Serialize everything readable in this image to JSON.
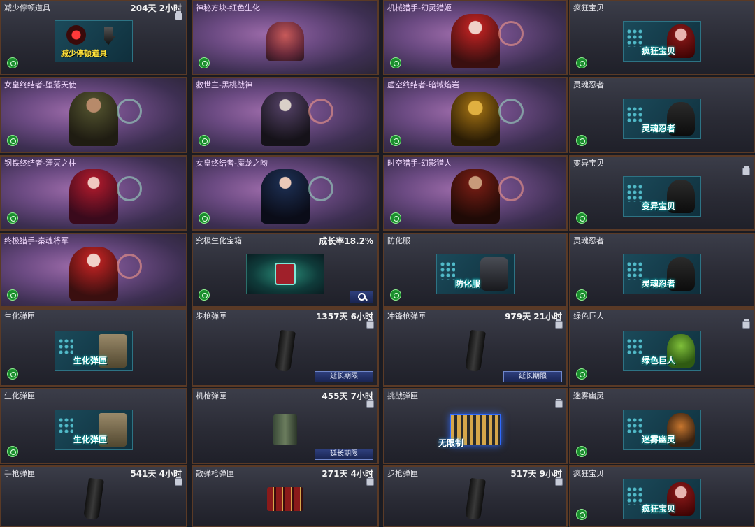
{
  "grid": {
    "rows": [
      [
        {
          "title": "减少停顿道具",
          "timer": "204天 2小时",
          "trash": true,
          "badge": true,
          "art": "reducer",
          "art_label": "减少停顿道具"
        },
        {
          "title": "神秘方块-红色生化",
          "theme": "purple",
          "badge": true,
          "art": "hero-small"
        },
        {
          "title": "机械猎手-幻灵猎姬",
          "theme": "purple",
          "badge": true,
          "art": "hero",
          "emblem": "red"
        },
        {
          "title": "疯狂宝贝",
          "badge": true,
          "art": "hexbox",
          "art_label": "疯狂宝贝",
          "art_figure": "red"
        }
      ],
      [
        {
          "title": "女皇终结者-堕落天使",
          "theme": "purple",
          "badge": true,
          "art": "hero",
          "emblem": "green"
        },
        {
          "title": "救世主-黑桃战神",
          "theme": "purple",
          "badge": true,
          "art": "hero",
          "emblem": "red"
        },
        {
          "title": "虚空终结者-暗域焰岩",
          "theme": "purple",
          "badge": true,
          "art": "hero",
          "emblem": "green"
        },
        {
          "title": "灵魂忍者",
          "badge": true,
          "art": "hexbox",
          "art_label": "灵魂忍者",
          "art_figure": "dark"
        }
      ],
      [
        {
          "title": "钢铁终结者-湮灭之柱",
          "theme": "purple",
          "badge": true,
          "art": "hero",
          "emblem": "green"
        },
        {
          "title": "女皇终结者-魔龙之吻",
          "theme": "purple",
          "badge": true,
          "art": "hero",
          "emblem": "green"
        },
        {
          "title": "时空猎手-幻影猎人",
          "theme": "purple",
          "badge": true,
          "art": "hero",
          "emblem": "red"
        },
        {
          "title": "变异宝贝",
          "trash": true,
          "badge": true,
          "art": "hexbox",
          "art_label": "变异宝贝",
          "art_figure": "dark"
        }
      ],
      [
        {
          "title": "终极猎手-秦魂将军",
          "theme": "purple",
          "badge": true,
          "art": "hero",
          "emblem": "red"
        },
        {
          "title": "究极生化宝箱",
          "timer": "成长率18.2%",
          "badge": true,
          "art": "chest",
          "magnify": true
        },
        {
          "title": "防化服",
          "badge": true,
          "art": "hexbox",
          "art_label": "防化服",
          "art_figure": "vest"
        },
        {
          "title": "灵魂忍者",
          "badge": true,
          "art": "hexbox",
          "art_label": "灵魂忍者",
          "art_figure": "dark"
        }
      ],
      [
        {
          "title": "生化弹匣",
          "badge": true,
          "art": "hexbox",
          "art_label": "生化弹匣",
          "art_figure": "kit"
        },
        {
          "title": "步枪弹匣",
          "timer": "1357天 6小时",
          "trash": true,
          "art": "mag",
          "extend": true
        },
        {
          "title": "冲锋枪弹匣",
          "timer": "979天 21小时",
          "trash": true,
          "art": "mag",
          "extend": true
        },
        {
          "title": "绿色巨人",
          "trash": true,
          "badge": true,
          "art": "hexbox",
          "art_label": "绿色巨人",
          "art_figure": "green"
        }
      ],
      [
        {
          "title": "生化弹匣",
          "badge": true,
          "art": "hexbox",
          "art_label": "生化弹匣",
          "art_figure": "kit"
        },
        {
          "title": "机枪弹匣",
          "timer": "455天 7小时",
          "trash": true,
          "art": "boxmag",
          "extend": true
        },
        {
          "title": "挑战弹匣",
          "trash": true,
          "art": "bullets",
          "art_label": "无限制"
        },
        {
          "title": "迷雾幽灵",
          "badge": true,
          "art": "hexbox",
          "art_label": "迷雾幽灵",
          "art_figure": "orange"
        }
      ],
      [
        {
          "title": "手枪弹匣",
          "timer": "541天 4小时",
          "trash": true,
          "art": "mag"
        },
        {
          "title": "散弹枪弹匣",
          "timer": "271天 4小时",
          "trash": true,
          "art": "shells"
        },
        {
          "title": "步枪弹匣",
          "timer": "517天 9小时",
          "trash": true,
          "art": "mag"
        },
        {
          "title": "疯狂宝贝",
          "badge": true,
          "art": "hexbox",
          "art_label": "疯狂宝贝",
          "art_figure": "red"
        }
      ]
    ]
  },
  "labels": {
    "extend_button": "延长期限"
  },
  "icons": {
    "badge": "recycle-badge-icon",
    "trash": "trash-icon",
    "magnify": "magnify-icon"
  },
  "colors": {
    "border": "#5a3a26",
    "purple_bg": "#6b4a82",
    "panel_bg": "#2a2b35",
    "button": "#1a2552"
  }
}
